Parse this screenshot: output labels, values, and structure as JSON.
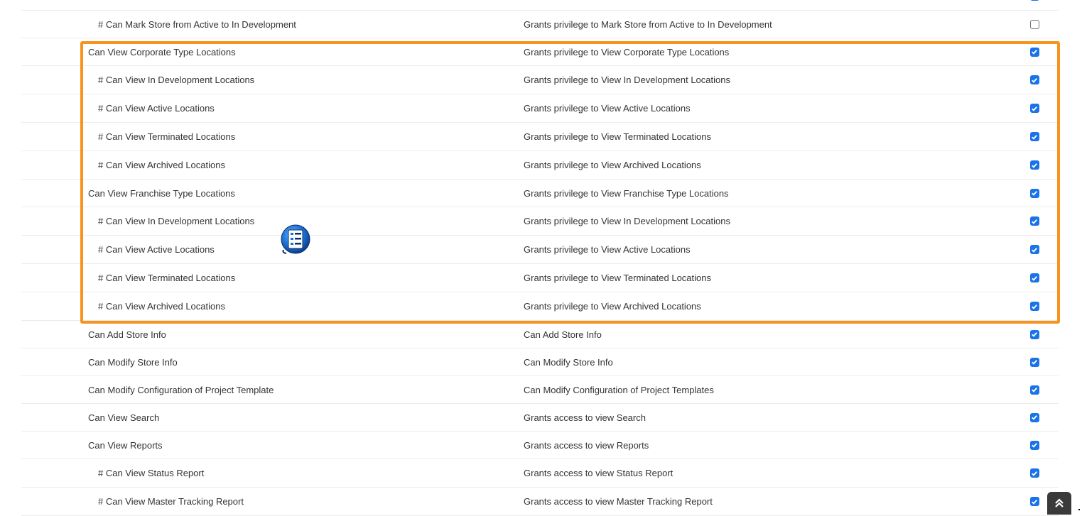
{
  "rows": [
    {
      "perm": "",
      "desc": "",
      "checked": true,
      "child": true
    },
    {
      "perm": "# Can Mark Store from Active to In Development",
      "desc": "Grants privilege to Mark Store from Active to In Development",
      "checked": false,
      "child": true
    },
    {
      "perm": "Can View Corporate Type Locations",
      "desc": "Grants privilege to View Corporate Type Locations",
      "checked": true,
      "child": false
    },
    {
      "perm": "# Can View In Development Locations",
      "desc": "Grants privilege to View In Development Locations",
      "checked": true,
      "child": true
    },
    {
      "perm": "# Can View Active Locations",
      "desc": "Grants privilege to View Active Locations",
      "checked": true,
      "child": true
    },
    {
      "perm": "# Can View Terminated Locations",
      "desc": "Grants privilege to View Terminated Locations",
      "checked": true,
      "child": true
    },
    {
      "perm": "# Can View Archived Locations",
      "desc": "Grants privilege to View Archived Locations",
      "checked": true,
      "child": true
    },
    {
      "perm": "Can View Franchise Type Locations",
      "desc": "Grants privilege to View Franchise Type Locations",
      "checked": true,
      "child": false
    },
    {
      "perm": "# Can View In Development Locations",
      "desc": "Grants privilege to View In Development Locations",
      "checked": true,
      "child": true
    },
    {
      "perm": "# Can View Active Locations",
      "desc": "Grants privilege to View Active Locations",
      "checked": true,
      "child": true
    },
    {
      "perm": "# Can View Terminated Locations",
      "desc": "Grants privilege to View Terminated Locations",
      "checked": true,
      "child": true
    },
    {
      "perm": "# Can View Archived Locations",
      "desc": "Grants privilege to View Archived Locations",
      "checked": true,
      "child": true
    },
    {
      "perm": "Can Add Store Info",
      "desc": "Can Add Store Info",
      "checked": true,
      "child": false
    },
    {
      "perm": "Can Modify Store Info",
      "desc": "Can Modify Store Info",
      "checked": true,
      "child": false
    },
    {
      "perm": "Can Modify Configuration of Project Template",
      "desc": "Can Modify Configuration of Project Templates",
      "checked": true,
      "child": false
    },
    {
      "perm": "Can View Search",
      "desc": "Grants access to view Search",
      "checked": true,
      "child": false
    },
    {
      "perm": "Can View Reports",
      "desc": "Grants access to view Reports",
      "checked": true,
      "child": false
    },
    {
      "perm": "# Can View Status Report",
      "desc": "Grants access to view Status Report",
      "checked": true,
      "child": true
    },
    {
      "perm": "# Can View Master Tracking Report",
      "desc": "Grants access to view Master Tracking Report",
      "checked": true,
      "child": true
    }
  ],
  "icons": {
    "floating": "numbered-list-icon",
    "scroll_top": "double-chevron-up-icon"
  },
  "colors": {
    "highlight": "#f7941d",
    "checkbox": "#1a73e8"
  }
}
